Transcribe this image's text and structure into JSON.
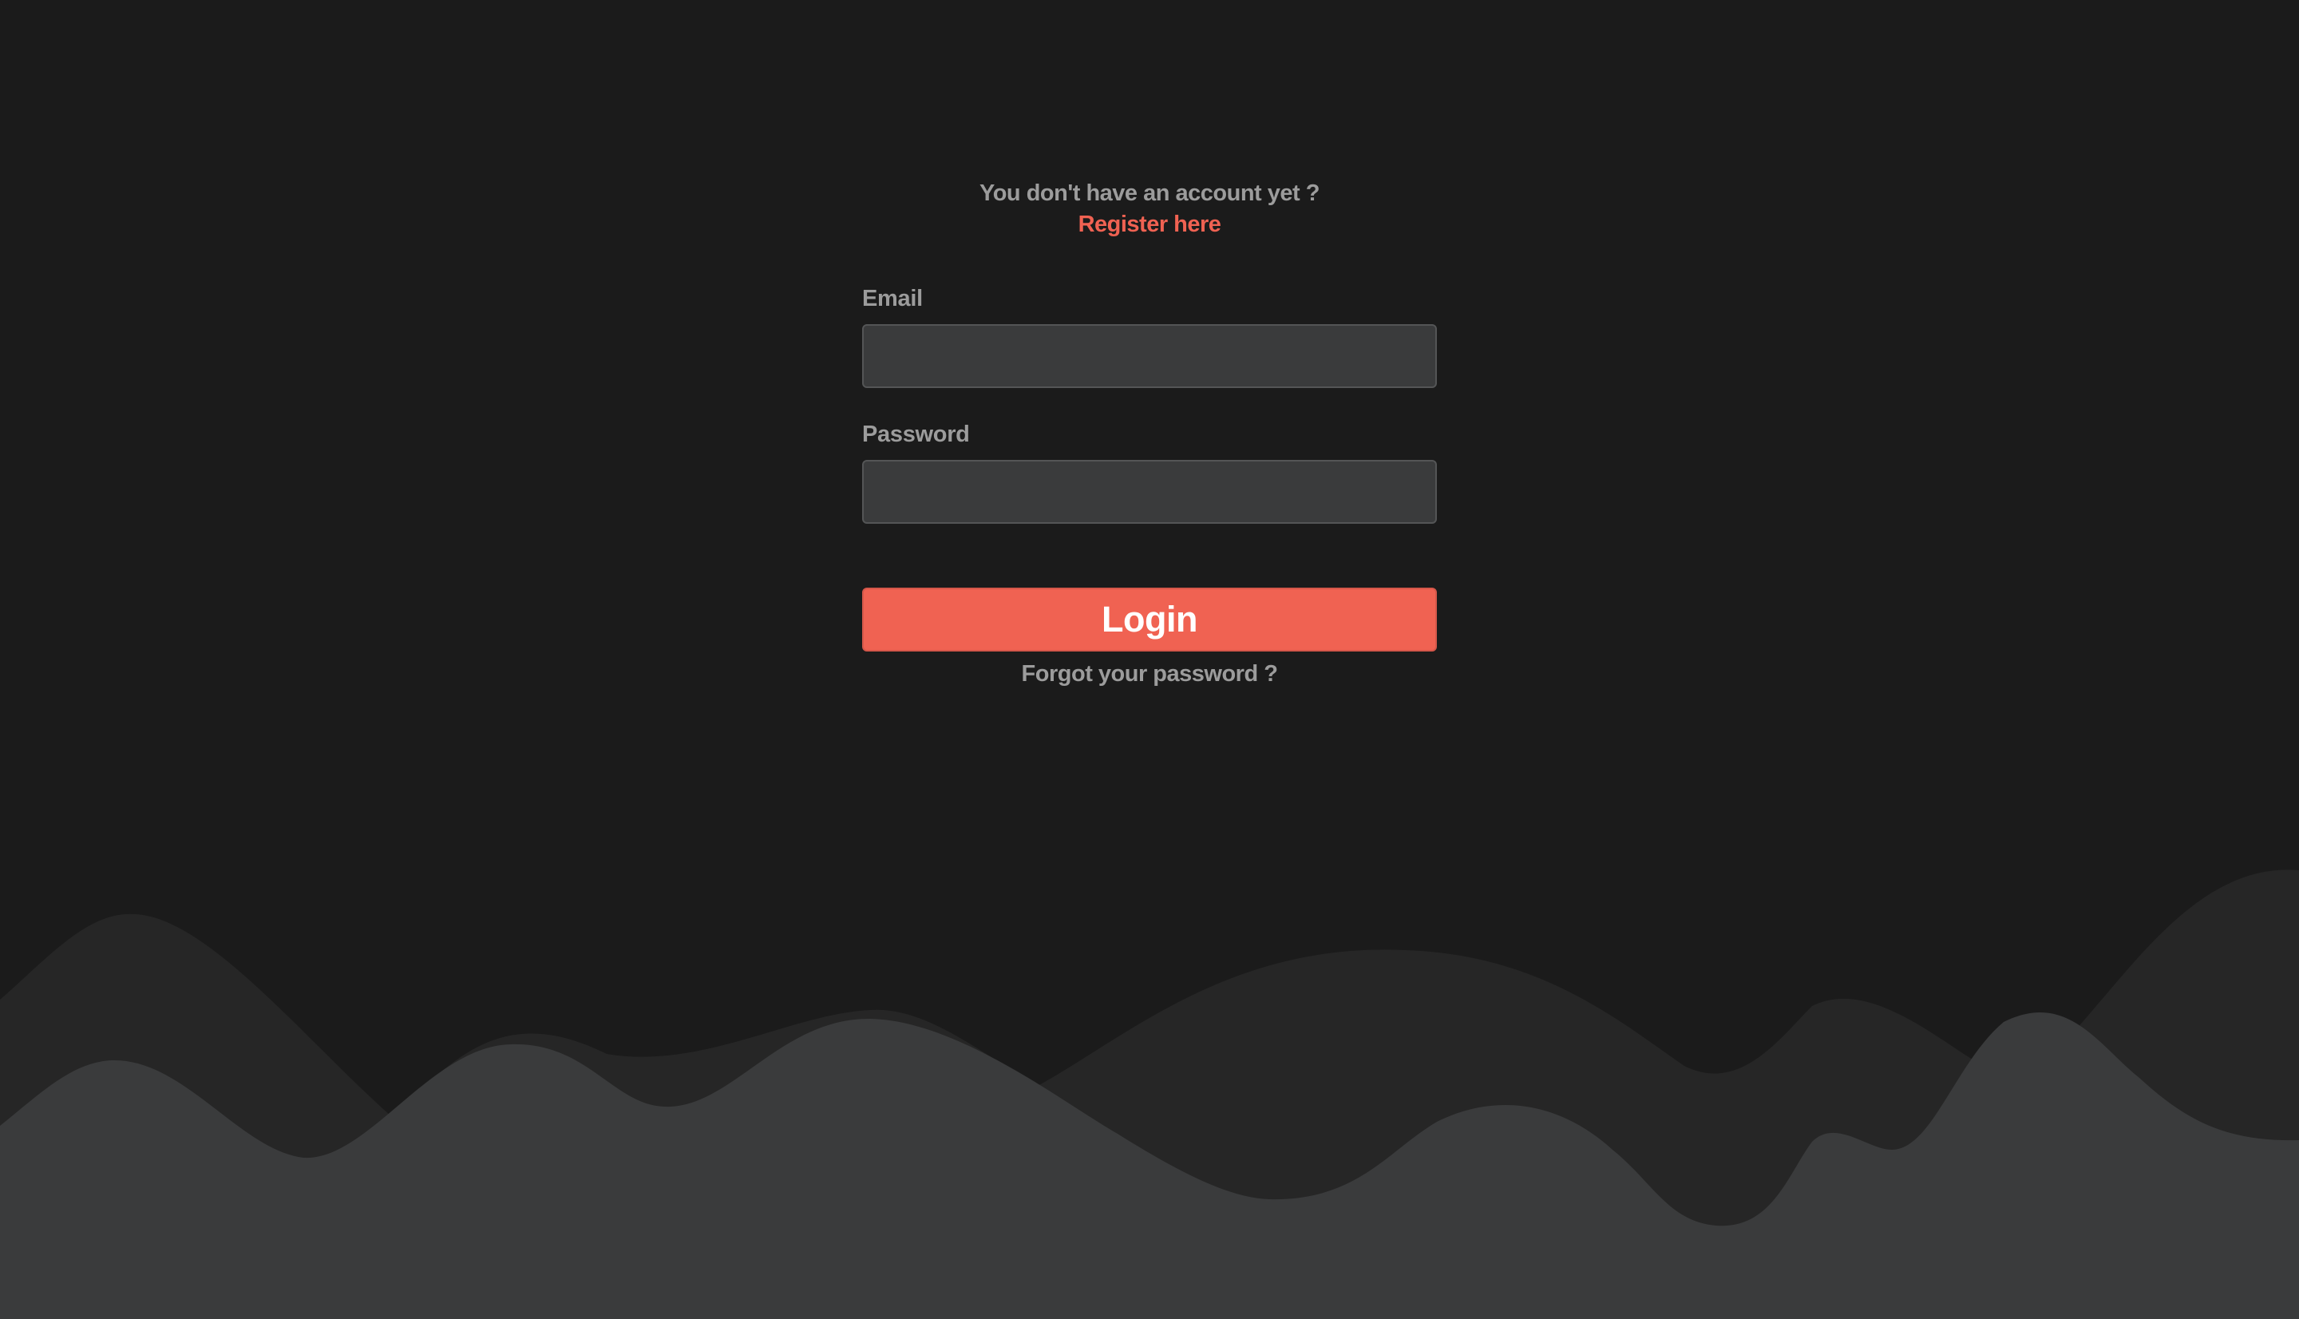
{
  "login_form": {
    "register_prompt": "You don't have an account yet ?",
    "register_link": "Register here",
    "email_label": "Email",
    "email_value": "",
    "password_label": "Password",
    "password_value": "",
    "login_button": "Login",
    "forgot_password_link": "Forgot your password ?"
  },
  "colors": {
    "background": "#1b1b1b",
    "wave_back": "#262626",
    "wave_front": "#3a3b3c",
    "accent": "#f06252",
    "muted_text": "#9c9c9c",
    "input_background": "#3a3b3c"
  }
}
